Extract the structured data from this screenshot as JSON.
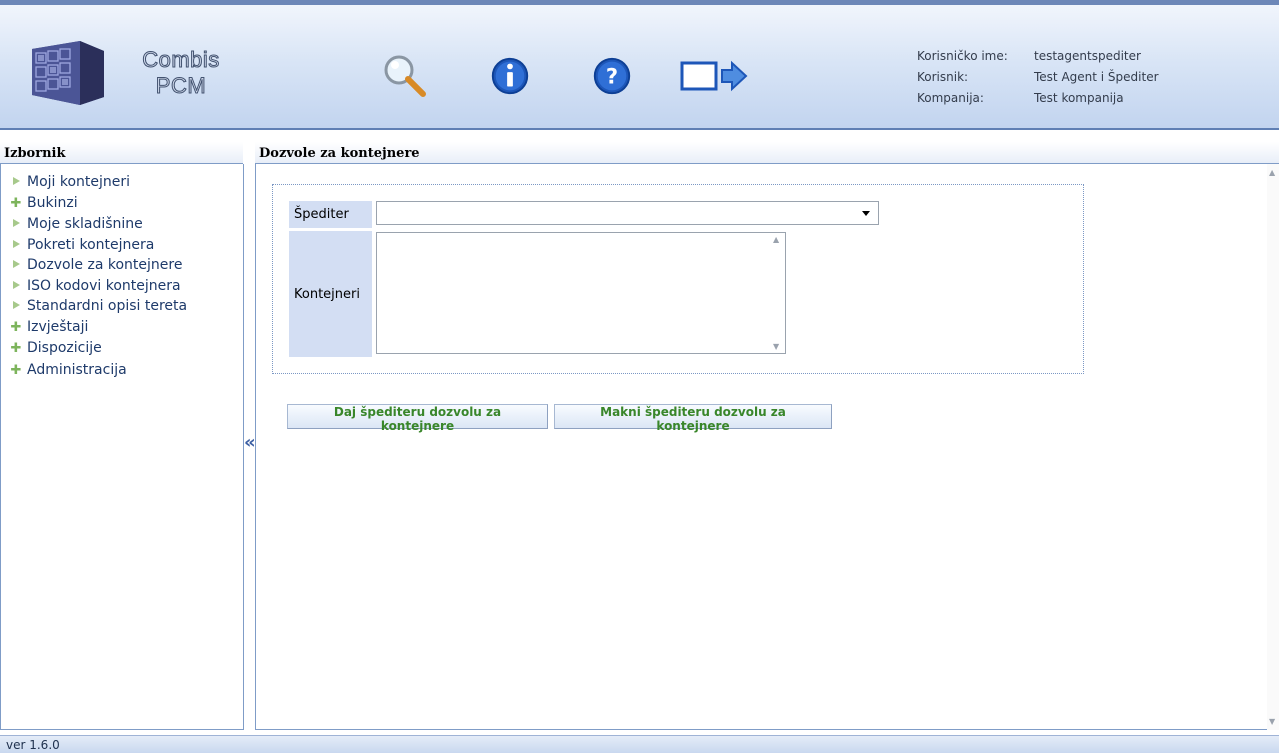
{
  "header": {
    "brand_line1": "Combis",
    "brand_line2": "PCM",
    "user_info": [
      {
        "label": "Korisničko ime:",
        "value": "testagentspediter"
      },
      {
        "label": "Korisnik:",
        "value": "Test Agent i Špediter"
      },
      {
        "label": "Kompanija:",
        "value": "Test kompanija"
      }
    ],
    "toolbar_icons": [
      "search-icon",
      "info-icon",
      "help-icon",
      "logout-icon"
    ]
  },
  "sidebar": {
    "title": "Izbornik",
    "items": [
      {
        "label": "Moji kontejneri",
        "icon": "arrow"
      },
      {
        "label": "Bukinzi",
        "icon": "plus"
      },
      {
        "label": "Moje skladišnine",
        "icon": "arrow"
      },
      {
        "label": "Pokreti kontejnera",
        "icon": "arrow"
      },
      {
        "label": "Dozvole za kontejnere",
        "icon": "arrow"
      },
      {
        "label": "ISO kodovi kontejnera",
        "icon": "arrow"
      },
      {
        "label": "Standardni opisi tereta",
        "icon": "arrow"
      },
      {
        "label": "Izvještaji",
        "icon": "plus"
      },
      {
        "label": "Dispozicije",
        "icon": "plus"
      },
      {
        "label": "Administracija",
        "icon": "plus"
      }
    ]
  },
  "main": {
    "title": "Dozvole za kontejnere",
    "form": {
      "spediter_label": "Špediter",
      "spediter_value": "",
      "kontejneri_label": "Kontejneri",
      "kontejneri_value": ""
    },
    "buttons": {
      "grant": "Daj špediteru dozvolu za kontejnere",
      "revoke": "Makni špediteru dozvolu za kontejnere"
    }
  },
  "footer": {
    "version": "ver 1.6.0"
  },
  "colors": {
    "header_bg": "#c2d4ef",
    "label_bg": "#d3def3",
    "menu_text": "#1e3a6a",
    "button_text": "#39862a"
  }
}
